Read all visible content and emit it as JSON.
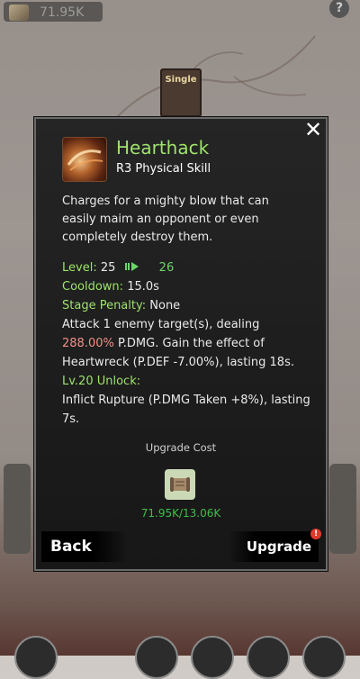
{
  "topbar": {
    "currency_value": "71.95K",
    "help": "?"
  },
  "tab": {
    "label": "Single"
  },
  "dialog": {
    "close": "✕",
    "skill": {
      "name": "Hearthack",
      "type": "R3 Physical Skill",
      "description": "Charges for a mighty blow that can easily maim an opponent or even completely destroy them."
    },
    "level": {
      "label": "Level:",
      "current": "25",
      "next": "26"
    },
    "cooldown": {
      "label": "Cooldown:",
      "value": "15.0s"
    },
    "stage_penalty": {
      "label": "Stage Penalty:",
      "value": "None"
    },
    "effect": {
      "pre": "Attack 1 enemy target(s), dealing ",
      "highlight": "288.00%",
      "post": " P.DMG. Gain the effect of Heartwreck (P.DEF -7.00%), lasting 18s."
    },
    "unlock": {
      "label": "Lv.20 Unlock:",
      "text": "Inflict Rupture (P.DMG Taken +8%), lasting 7s."
    },
    "upgrade_cost": {
      "title": "Upgrade Cost",
      "value": "71.95K/13.06K"
    },
    "buttons": {
      "back": "Back",
      "upgrade": "Upgrade",
      "badge": "!"
    }
  },
  "colors": {
    "skill_name": "#9ee36c",
    "highlight": "#f09088",
    "cost": "#3ebf48"
  }
}
